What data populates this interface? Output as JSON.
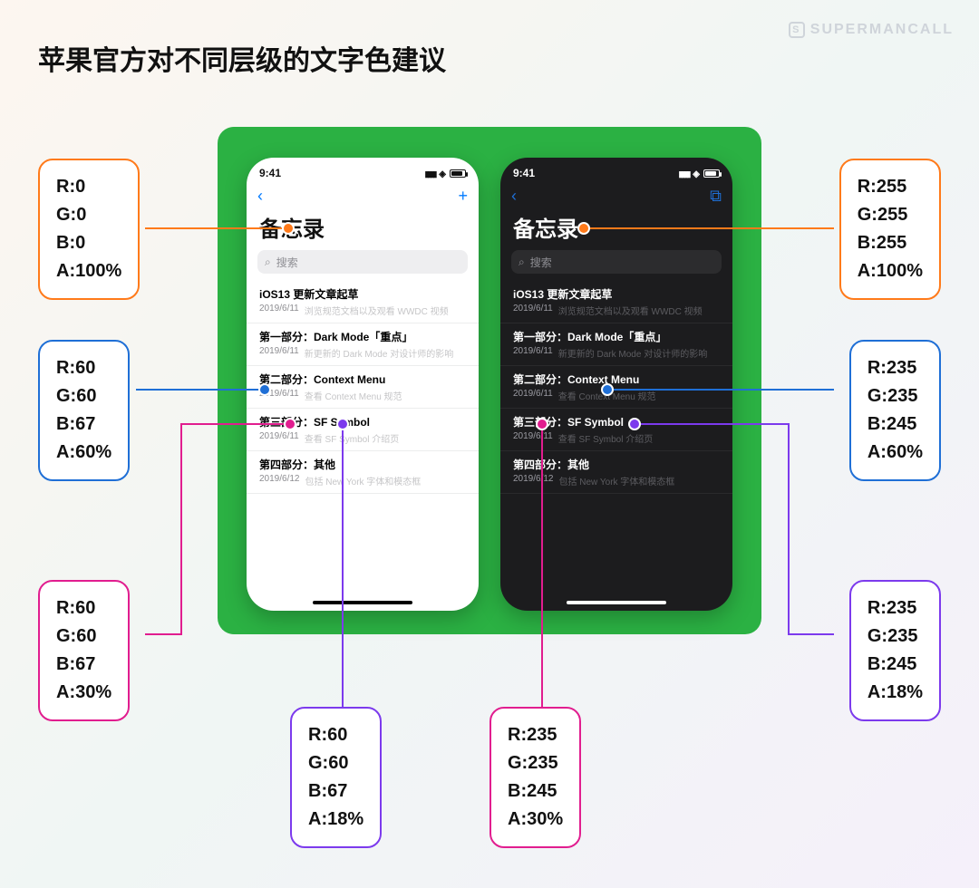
{
  "brand": "SUPERMANCALL",
  "title": "苹果官方对不同层级的文字色建议",
  "statusbar": {
    "time": "9:41"
  },
  "nav": {
    "back_glyph": "‹",
    "add_glyph": "+",
    "new_glyph": "⧉"
  },
  "app_title": "备忘录",
  "search_placeholder": "搜索",
  "notes": [
    {
      "title": "iOS13 更新文章起草",
      "date": "2019/6/11",
      "preview": "浏览规范文档以及观看 WWDC 视频"
    },
    {
      "title": "第一部分：Dark Mode「重点」",
      "date": "2019/6/11",
      "preview": "新更新的 Dark Mode 对设计师的影响"
    },
    {
      "title": "第二部分：Context Menu",
      "date": "2019/6/11",
      "preview": "查看 Context Menu 规范"
    },
    {
      "title": "第三部分：SF Symbol",
      "date": "2019/6/11",
      "preview": "查看 SF Symbol 介绍页"
    },
    {
      "title": "第四部分：其他",
      "date": "2019/6/12",
      "preview": "包括 New York 字体和模态框"
    }
  ],
  "callouts": {
    "light_primary": {
      "R": "R:0",
      "G": "G:0",
      "B": "B:0",
      "A": "A:100%"
    },
    "light_secondary": {
      "R": "R:60",
      "G": "G:60",
      "B": "B:67",
      "A": "A:60%"
    },
    "light_tertiary": {
      "R": "R:60",
      "G": "G:60",
      "B": "B:67",
      "A": "A:30%"
    },
    "light_quaternary": {
      "R": "R:60",
      "G": "G:60",
      "B": "B:67",
      "A": "A:18%"
    },
    "dark_primary": {
      "R": "R:255",
      "G": "G:255",
      "B": "B:255",
      "A": "A:100%"
    },
    "dark_secondary": {
      "R": "R:235",
      "G": "G:235",
      "B": "B:245",
      "A": "A:60%"
    },
    "dark_tertiary": {
      "R": "R:235",
      "G": "G:235",
      "B": "B:245",
      "A": "A:30%"
    },
    "dark_quaternary": {
      "R": "R:235",
      "G": "G:235",
      "B": "B:245",
      "A": "A:18%"
    }
  }
}
